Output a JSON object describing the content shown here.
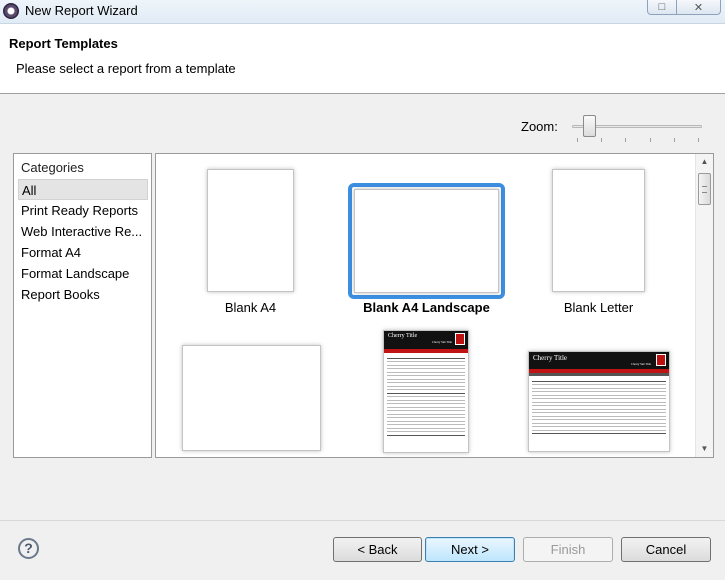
{
  "window": {
    "title": "New Report Wizard",
    "icon": "report-wizard-icon",
    "controls": {
      "maximize": "□",
      "close": "✕"
    }
  },
  "header": {
    "title": "Report Templates",
    "subtitle": "Please select a report from a template"
  },
  "zoom": {
    "label": "Zoom:",
    "level": 0.1
  },
  "categories": {
    "header": "Categories",
    "items": [
      {
        "label": "All",
        "selected": true
      },
      {
        "label": "Print Ready Reports"
      },
      {
        "label": "Web Interactive Re..."
      },
      {
        "label": "Format A4"
      },
      {
        "label": "Format Landscape"
      },
      {
        "label": "Report Books"
      }
    ]
  },
  "templates": {
    "items": [
      {
        "label": "Blank A4"
      },
      {
        "label": "Blank A4 Landscape",
        "selected": true
      },
      {
        "label": "Blank Letter"
      },
      {
        "label": ""
      },
      {
        "label": "",
        "preview_title": "Cherry Title",
        "preview_subtitle": "Cherry Sub Title"
      },
      {
        "label": "",
        "preview_title": "Cherry Title",
        "preview_subtitle": "Cherry Sub Title"
      }
    ]
  },
  "buttons": {
    "back": "< Back",
    "next": "Next >",
    "finish": "Finish",
    "cancel": "Cancel",
    "help": "?"
  },
  "colors": {
    "selection_accent": "#3c8ee0",
    "cherry_red": "#c01414",
    "cherry_black": "#111111"
  }
}
